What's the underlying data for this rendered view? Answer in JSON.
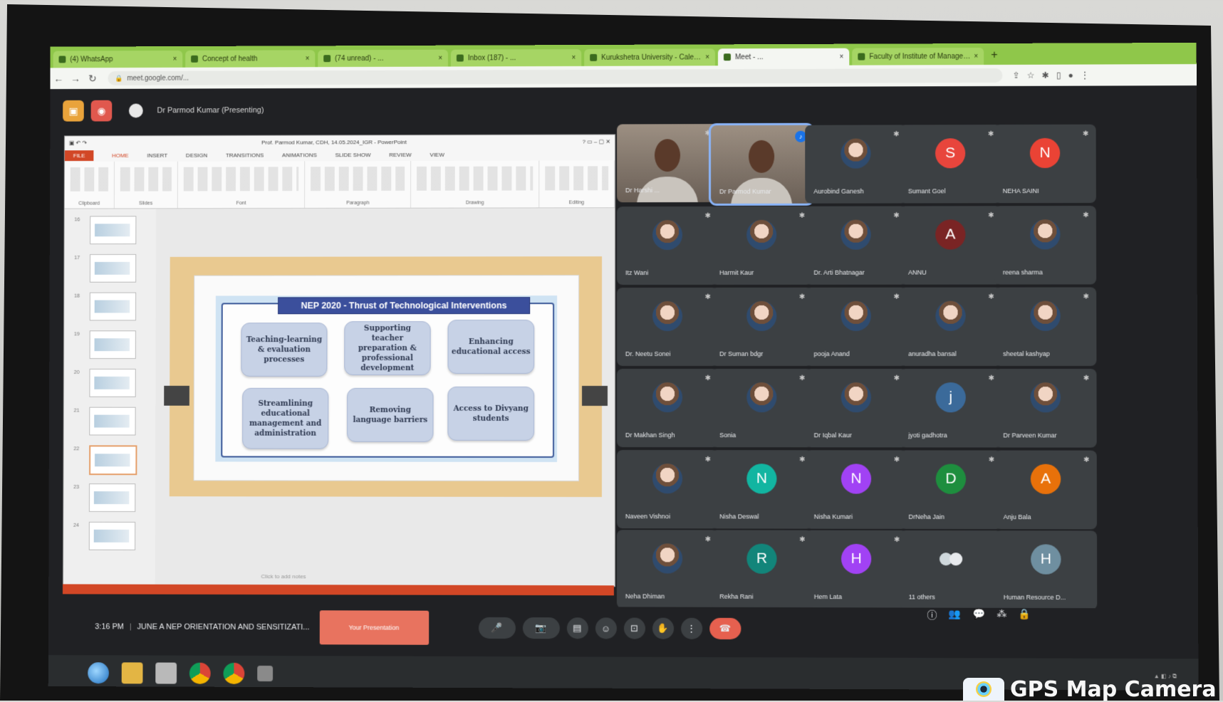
{
  "browser": {
    "tabs": [
      {
        "title": "(4) WhatsApp"
      },
      {
        "title": "Concept of health"
      },
      {
        "title": "(74 unread) - ..."
      },
      {
        "title": "Inbox (187) - ..."
      },
      {
        "title": "Kurukshetra University - Calendar"
      },
      {
        "title": "Meet - ..."
      },
      {
        "title": "Faculty of Institute of Management"
      }
    ],
    "new_tab": "+",
    "url": "meet.google.com/..."
  },
  "meet": {
    "presenter_label": "Dr Parmod Kumar (Presenting)",
    "clock": "3:16 PM",
    "meeting_title": "JUNE A NEP ORIENTATION AND SENSITIZATI...",
    "present_button": "Your Presentation"
  },
  "powerpoint": {
    "window_title": "Prof. Parmod Kumar, CDH, 14.05.2024_IGR - PowerPoint",
    "ribbon_tabs": [
      "FILE",
      "HOME",
      "INSERT",
      "DESIGN",
      "TRANSITIONS",
      "ANIMATIONS",
      "SLIDE SHOW",
      "REVIEW",
      "VIEW"
    ],
    "ribbon_groups": [
      "Clipboard",
      "Slides",
      "Font",
      "Paragraph",
      "Drawing",
      "Editing"
    ],
    "notes_placeholder": "Click to add notes",
    "slide_numbers": [
      "16",
      "17",
      "18",
      "19",
      "20",
      "21",
      "22",
      "23",
      "24"
    ]
  },
  "slide": {
    "title": "NEP 2020 - Thrust of Technological Interventions",
    "boxes": [
      "Teaching-learning & evaluation processes",
      "Supporting teacher preparation & professional development",
      "Enhancing educational access",
      "Streamlining educational management and administration",
      "Removing language barriers",
      "Access to Divyang students"
    ]
  },
  "participants": [
    {
      "name": "Dr Harshi ...",
      "type": "video"
    },
    {
      "name": "Dr Parmod Kumar",
      "type": "video",
      "speaking": true
    },
    {
      "name": "Aurobind Ganesh",
      "type": "photo"
    },
    {
      "name": "Sumant Goel",
      "type": "letter",
      "letter": "S",
      "color": "#e8453c"
    },
    {
      "name": "NEHA SAINI",
      "type": "letter",
      "letter": "N",
      "color": "#ea4335"
    },
    {
      "name": "Itz Wani",
      "type": "photo"
    },
    {
      "name": "Harmit Kaur",
      "type": "photo"
    },
    {
      "name": "Dr. Arti Bhatnagar",
      "type": "photo"
    },
    {
      "name": "ANNU",
      "type": "letter",
      "letter": "A",
      "color": "#7a2424"
    },
    {
      "name": "reena sharma",
      "type": "photo"
    },
    {
      "name": "Dr. Neetu Sonei",
      "type": "photo"
    },
    {
      "name": "Dr Suman bdgr",
      "type": "photo"
    },
    {
      "name": "pooja Anand",
      "type": "photo"
    },
    {
      "name": "anuradha bansal",
      "type": "photo"
    },
    {
      "name": "sheetal kashyap",
      "type": "photo"
    },
    {
      "name": "Dr Makhan Singh",
      "type": "photo"
    },
    {
      "name": "Sonia",
      "type": "photo"
    },
    {
      "name": "Dr Iqbal Kaur",
      "type": "photo"
    },
    {
      "name": "jyoti gadhotra",
      "type": "letter",
      "letter": "j",
      "color": "#3b6a9a"
    },
    {
      "name": "Dr Parveen Kumar",
      "type": "photo"
    },
    {
      "name": "Naveen Vishnoi",
      "type": "photo"
    },
    {
      "name": "Nisha Deswal",
      "type": "letter",
      "letter": "N",
      "color": "#12b5a1"
    },
    {
      "name": "Nisha Kumari",
      "type": "letter",
      "letter": "N",
      "color": "#a142f4"
    },
    {
      "name": "DrNeha Jain",
      "type": "letter",
      "letter": "D",
      "color": "#1e8e3e"
    },
    {
      "name": "Anju Bala",
      "type": "letter",
      "letter": "A",
      "color": "#e8710a"
    },
    {
      "name": "Neha Dhiman",
      "type": "photo"
    },
    {
      "name": "Rekha Rani",
      "type": "letter",
      "letter": "R",
      "color": "#12857a"
    },
    {
      "name": "Hem Lata",
      "type": "letter",
      "letter": "H",
      "color": "#a142f4"
    },
    {
      "name": "11 others",
      "type": "others"
    },
    {
      "name": "Human Resource D...",
      "type": "letter",
      "letter": "H",
      "color": "#6f8fa0"
    }
  ],
  "watermark": "GPS Map Camera"
}
